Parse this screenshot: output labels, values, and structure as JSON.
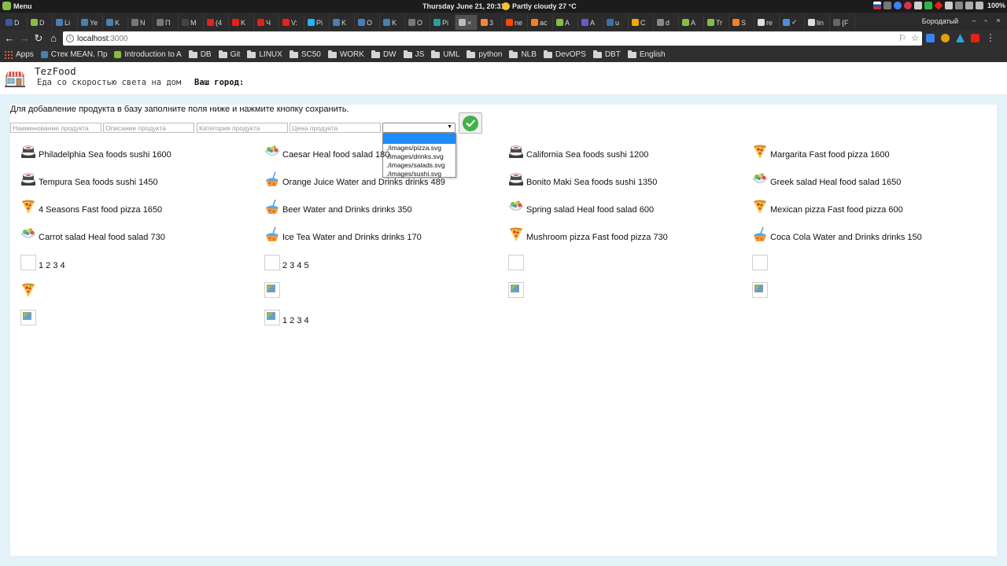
{
  "os": {
    "menu_label": "Menu",
    "clock": "Thursday June 21, 20:31",
    "weather": "Partly cloudy 27 °C",
    "battery": "100%"
  },
  "browser": {
    "tabs": [
      {
        "title": "D",
        "color": "#3b5998"
      },
      {
        "title": "D",
        "color": "#86be43"
      },
      {
        "title": "Li",
        "color": "#4a7fb0"
      },
      {
        "title": "Ye",
        "color": "#4a7fb0"
      },
      {
        "title": "K",
        "color": "#4a7fb0"
      },
      {
        "title": "N",
        "color": "#777777"
      },
      {
        "title": "П",
        "color": "#777777"
      },
      {
        "title": "M",
        "color": "#444444"
      },
      {
        "title": "(4",
        "color": "#e62117"
      },
      {
        "title": "K",
        "color": "#e62117"
      },
      {
        "title": "Ч",
        "color": "#e62117"
      },
      {
        "title": "V:",
        "color": "#e62117"
      },
      {
        "title": "Pi",
        "color": "#1fb6ff"
      },
      {
        "title": "K",
        "color": "#4a7fb0"
      },
      {
        "title": "O",
        "color": "#4a7fb0"
      },
      {
        "title": "K",
        "color": "#4a7fb0"
      },
      {
        "title": "O",
        "color": "#777777"
      },
      {
        "title": "Pi",
        "color": "#2aa198"
      },
      {
        "title": "×",
        "color": "#bbbbbb"
      },
      {
        "title": "3",
        "color": "#f4843b"
      },
      {
        "title": "ne",
        "color": "#ff4500"
      },
      {
        "title": "ac",
        "color": "#f48024"
      },
      {
        "title": "A",
        "color": "#86be43"
      },
      {
        "title": "A",
        "color": "#6a5acd"
      },
      {
        "title": "u",
        "color": "#3a6fb0"
      },
      {
        "title": "C",
        "color": "#f2a900"
      },
      {
        "title": "d",
        "color": "#888888"
      },
      {
        "title": "A",
        "color": "#86be43"
      },
      {
        "title": "Tr",
        "color": "#86be43"
      },
      {
        "title": "S",
        "color": "#f48024"
      },
      {
        "title": "re",
        "color": "#dddddd"
      },
      {
        "title": "✓",
        "color": "#4a90d9"
      },
      {
        "title": "lin",
        "color": "#dddddd"
      },
      {
        "title": "{F",
        "color": "#666666"
      }
    ],
    "profile_name": "Бородатый",
    "url_host": "localhost",
    "url_port": ":3000",
    "bookmarks": [
      {
        "label": "Apps",
        "type": "apps"
      },
      {
        "label": "Стек MEAN. Пр",
        "type": "site",
        "color": "#4a7fb0"
      },
      {
        "label": "Introduction to A",
        "type": "site",
        "color": "#86be43"
      },
      {
        "label": "DB",
        "type": "folder"
      },
      {
        "label": "Git",
        "type": "folder"
      },
      {
        "label": "LINUX",
        "type": "folder"
      },
      {
        "label": "SC50",
        "type": "folder"
      },
      {
        "label": "WORK",
        "type": "folder"
      },
      {
        "label": "DW",
        "type": "folder"
      },
      {
        "label": "JS",
        "type": "folder"
      },
      {
        "label": "UML",
        "type": "folder"
      },
      {
        "label": "python",
        "type": "folder"
      },
      {
        "label": "NLB",
        "type": "folder"
      },
      {
        "label": "DevOPS",
        "type": "folder"
      },
      {
        "label": "DBT",
        "type": "folder"
      },
      {
        "label": "English",
        "type": "folder"
      }
    ]
  },
  "site": {
    "brand": "TezFood",
    "tagline": "Еда со скоростью света на дом",
    "city_label": "Ваш город:"
  },
  "form": {
    "hint": "Для добавление продукта в базу заполните поля ниже и нажмите кнопку сохранить.",
    "name_placeholder": "Наименование продукта",
    "description_placeholder": "Описание продукта",
    "category_placeholder": "Категория продукта",
    "price_placeholder": "Цена продукта",
    "image_options": [
      "",
      "./images/pizza.svg",
      "./images/drinks.svg",
      "./images/salads.svg",
      "./images/sushi.svg"
    ]
  },
  "products": [
    {
      "icon": "sushi",
      "text": "Philadelphia Sea foods sushi 1600"
    },
    {
      "icon": "salad",
      "text": "Caesar Heal food salad 180"
    },
    {
      "icon": "sushi",
      "text": "California Sea foods sushi 1200"
    },
    {
      "icon": "pizza",
      "text": "Margarita Fast food pizza 1600"
    },
    {
      "icon": "sushi",
      "text": "Tempura Sea foods sushi 1450"
    },
    {
      "icon": "drink",
      "text": "Orange Juice Water and Drinks drinks 489"
    },
    {
      "icon": "sushi",
      "text": "Bonito Maki Sea foods sushi 1350"
    },
    {
      "icon": "salad",
      "text": "Greek salad Heal food salad 1650"
    },
    {
      "icon": "pizza",
      "text": "4 Seasons Fast food pizza 1650"
    },
    {
      "icon": "drink",
      "text": "Beer Water and Drinks drinks 350"
    },
    {
      "icon": "salad",
      "text": "Spring salad Heal food salad 600"
    },
    {
      "icon": "pizza",
      "text": "Mexican pizza Fast food pizza 600"
    },
    {
      "icon": "salad",
      "text": "Carrot salad Heal food salad 730"
    },
    {
      "icon": "drink",
      "text": "Ice Tea Water and Drinks drinks 170"
    },
    {
      "icon": "pizza",
      "text": "Mushroom pizza Fast food pizza 730"
    },
    {
      "icon": "drink",
      "text": "Coca Cola Water and Drinks drinks 150"
    },
    {
      "icon": "empty",
      "text": "1 2 3 4"
    },
    {
      "icon": "empty",
      "text": "2 3 4 5"
    },
    {
      "icon": "empty",
      "text": ""
    },
    {
      "icon": "empty",
      "text": ""
    },
    {
      "icon": "pizza",
      "text": ""
    },
    {
      "icon": "broken",
      "text": ""
    },
    {
      "icon": "broken",
      "text": ""
    },
    {
      "icon": "broken",
      "text": ""
    },
    {
      "icon": "broken",
      "text": ""
    },
    {
      "icon": "broken",
      "text": "1 2 3 4"
    }
  ],
  "colors": {
    "page_bg": "#e3f1f8",
    "panel_bg": "#ffffff",
    "save_green": "#42b14b",
    "dropdown_highlight": "#1e8cf8"
  }
}
